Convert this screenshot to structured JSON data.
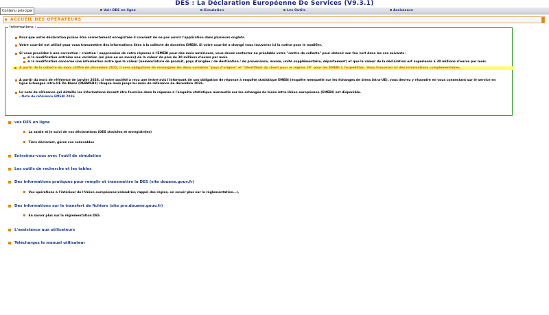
{
  "app": {
    "title": "DES : La Déclaration Européenne De Services (V9.3.1)"
  },
  "nav": {
    "first": "Contenu principal",
    "items": [
      "Voir DES en ligne",
      "Simulation",
      "Les Outils",
      "Assistance"
    ]
  },
  "accueil": {
    "title": "ACCUEIL DES OPÉRATEURS"
  },
  "info": {
    "legend": "Informations :",
    "p1": "Pour que votre déclaration puisse être correctement enregistrée il convient de ne pas ouvrir l'application dans plusieurs onglets.",
    "p2": "Votre courriel est utilisé pour vous transmettre des informations liées à la collecte de données EMEBI. Si votre courriel a changé vous trouverez ici la notice pour le modifier.",
    "p3": "Si vous procédez à une correction / création / suppression de votre réponse à l'EMEBI pour des mois antérieurs, vous devez contacter au préalable votre \"centre de collecte\" pour obtenir son feu vert dans les cas suivants :",
    "p3a": "si la modification entraîne une variation (en plus ou en moins) de la valeur de plus de 30 millions d'euros par mois.",
    "p3b": "si la modification concerne une information autre que la valeur (nomenclature de produit, pays d'origine / de destination / de provenance, masse, unité supplémentaire, département) et que la valeur de la déclaration est supérieure à 30 millions d'euros par mois.",
    "p4": "A partir de la collecte du mois chiffré de décembre 2025, il sera obligatoire de renseigner les deux variables \"pays d'origine\" et \"identifiant du client pour le régime 29\" pour les EMEBI à l'expédition. Vous trouverez ici des informations complémentaires.",
    "p5a": "A partir du mois de référence de janvier 2026, si votre société a reçu une lettre-avis l'informant de son obligation de réponse à enquête statistique EMEBI (enquête mensuelle sur les échanges de biens intra-UE), vous devrez y répondre en vous connectant sur le service en",
    "p5b": "ligne Echanges intra-UE De Biens (DEBWEB2) chaque mois jusqu'au mois de référence de décembre 2026.",
    "p6": "La note de référence qui détaille les informations devant être fournies dans la réponse à l'enquête statistique mensuelle sur les échanges de biens intra-Union européenne (EMEBI) est disponible.",
    "p6link": "- Note de référence EMEBI 2026"
  },
  "sections": [
    {
      "label": "vos DES en ligne"
    },
    {
      "label": "Entraînez-vous avec l'outil de simulation"
    },
    {
      "label": "Les outils de recherche et les tables"
    },
    {
      "label": "Des informations pratiques pour remplir et transmettre la DES (site douane.gouv.fr)"
    },
    {
      "label": "Des informations sur le transfert de fichiers (site pro.douane.gouv.fr)"
    },
    {
      "label": "L'assistance aux utilisateurs"
    },
    {
      "label": "Téléchargez le manuel utilisateur"
    }
  ],
  "subitems": {
    "des1": "La saisie et le suivi de vos déclarations (DES stockées et enregistrées)",
    "des2": "Tiers déclarant, gérez vos redevables",
    "info": "Vos opérations à l'intérieur de l'Union européenne(calendrier, rappel des règles, en savoir plus sur la réglementation...).",
    "transfert": "En savoir plus sur la réglementation DES"
  }
}
